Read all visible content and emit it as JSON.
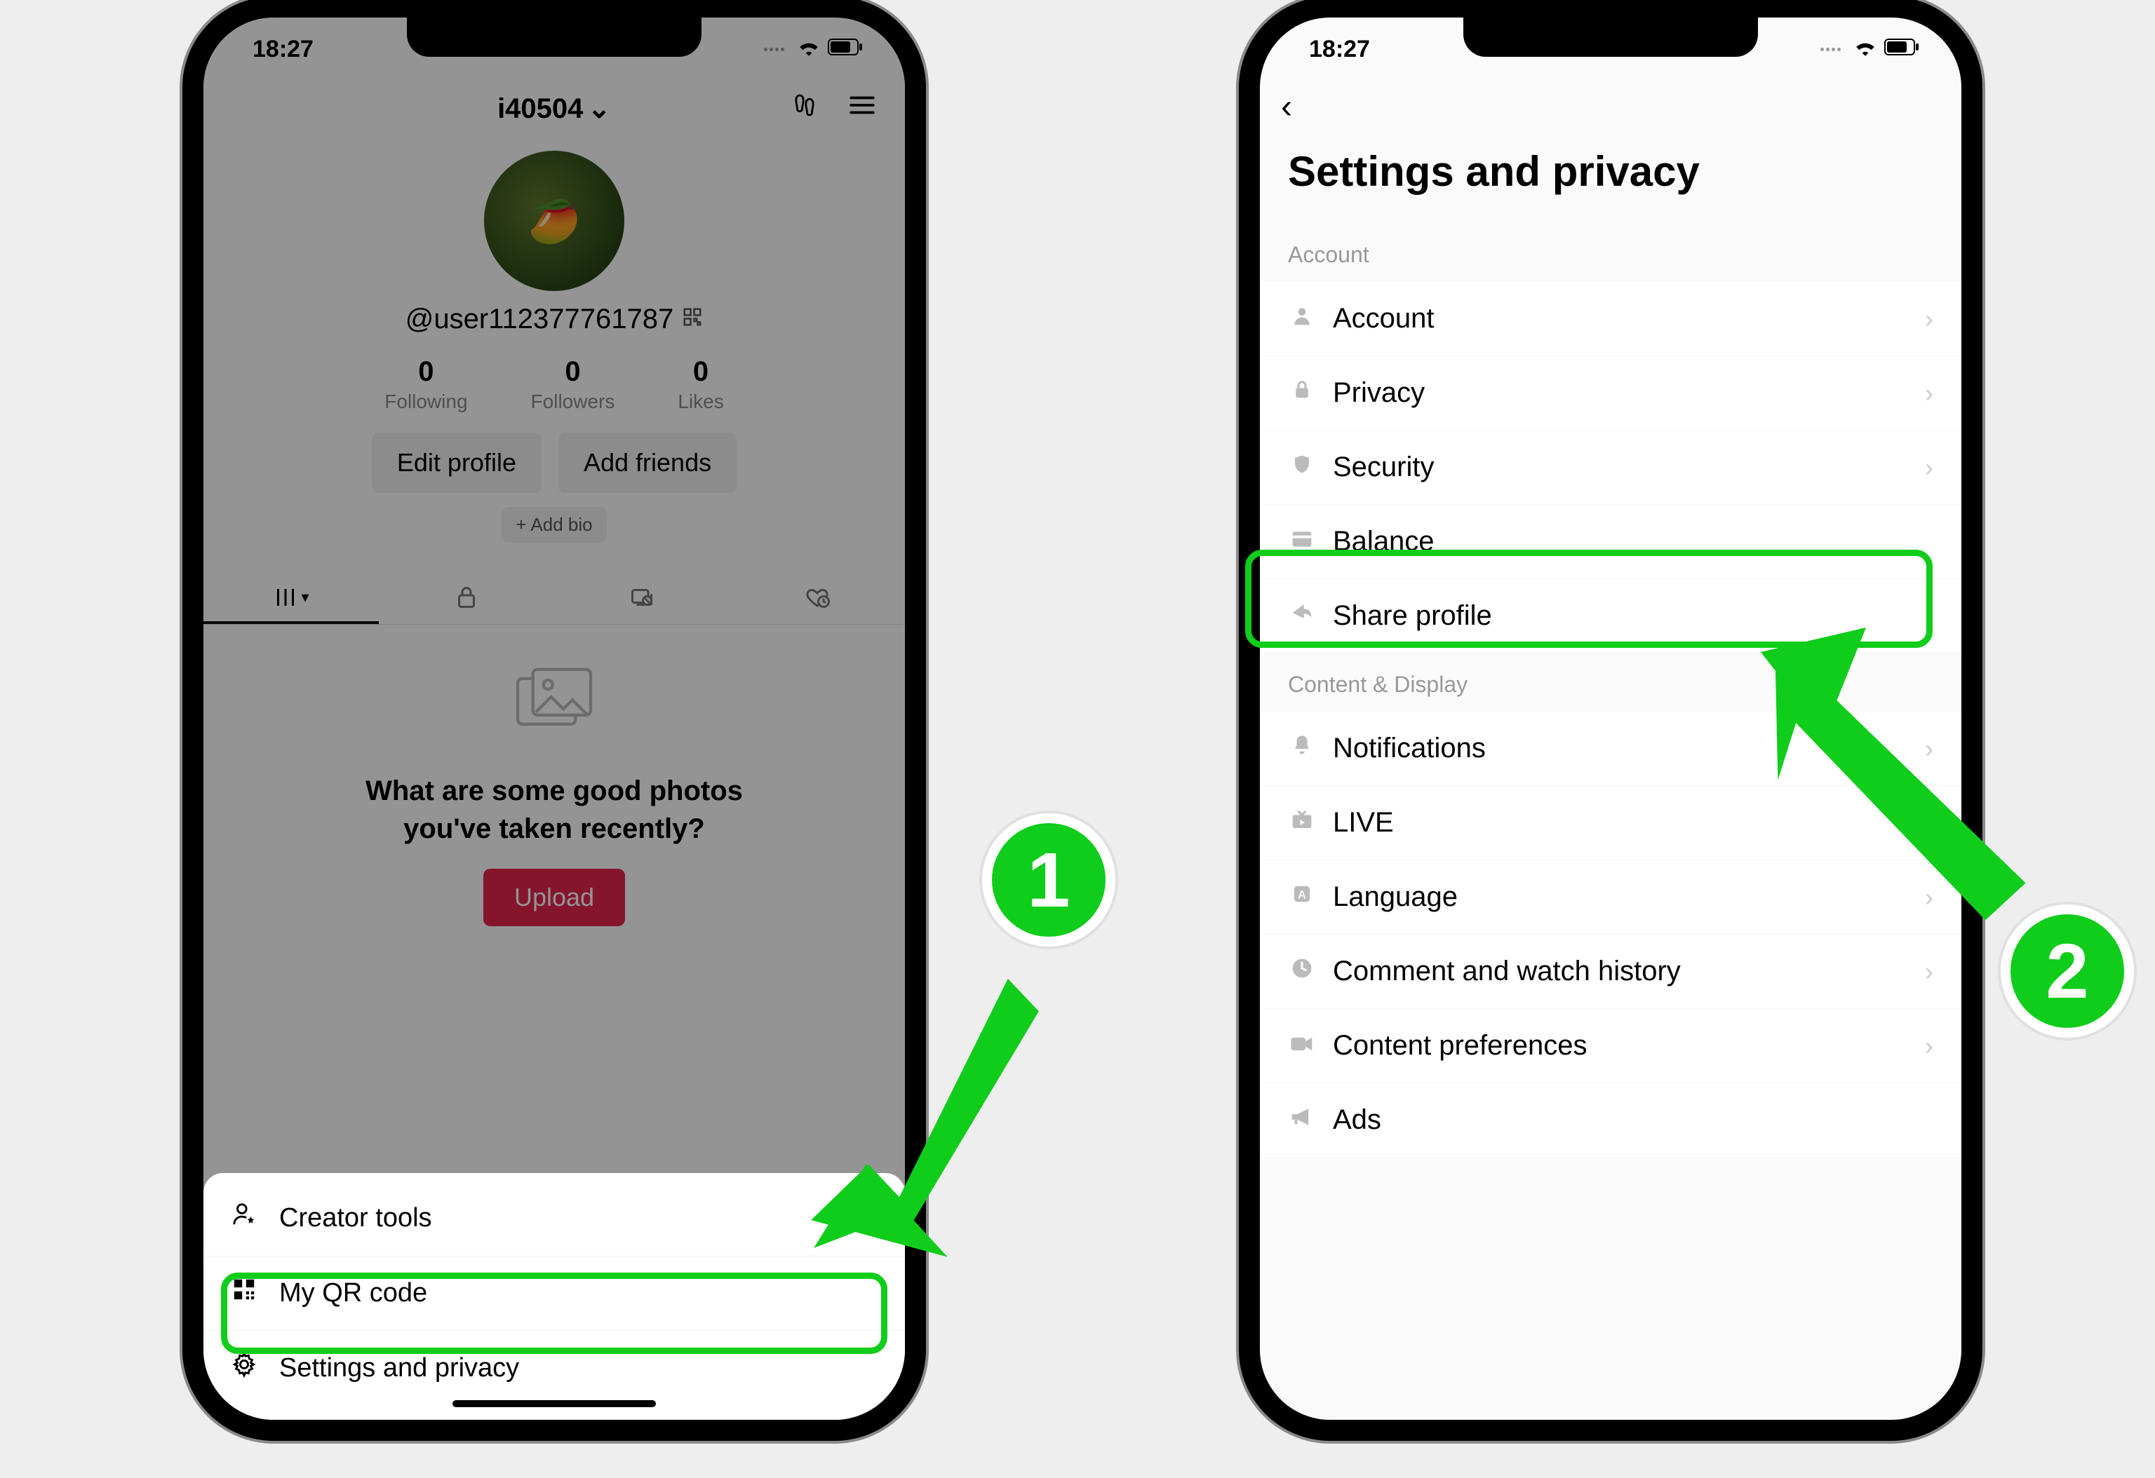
{
  "status_time": "18:27",
  "phone1": {
    "username_dropdown": "i40504",
    "handle": "@user112377761787",
    "stats": {
      "following": {
        "value": "0",
        "label": "Following"
      },
      "followers": {
        "value": "0",
        "label": "Followers"
      },
      "likes": {
        "value": "0",
        "label": "Likes"
      }
    },
    "edit_profile_btn": "Edit profile",
    "add_friends_btn": "Add friends",
    "add_bio_btn": "+ Add bio",
    "empty_prompt_line1": "What are some good photos",
    "empty_prompt_line2": "you've taken recently?",
    "upload_btn": "Upload",
    "sheet": {
      "creator_tools": "Creator tools",
      "qr_code": "My QR code",
      "settings_privacy": "Settings and privacy"
    }
  },
  "phone2": {
    "title": "Settings and privacy",
    "section_account": "Account",
    "items_account": {
      "account": "Account",
      "privacy": "Privacy",
      "security": "Security",
      "balance": "Balance",
      "share_profile": "Share profile"
    },
    "section_content": "Content & Display",
    "items_content": {
      "notifications": "Notifications",
      "live": "LIVE",
      "language": "Language",
      "comment_history": "Comment and watch history",
      "content_prefs": "Content preferences",
      "ads": "Ads"
    }
  },
  "callouts": {
    "step1": "1",
    "step2": "2"
  }
}
